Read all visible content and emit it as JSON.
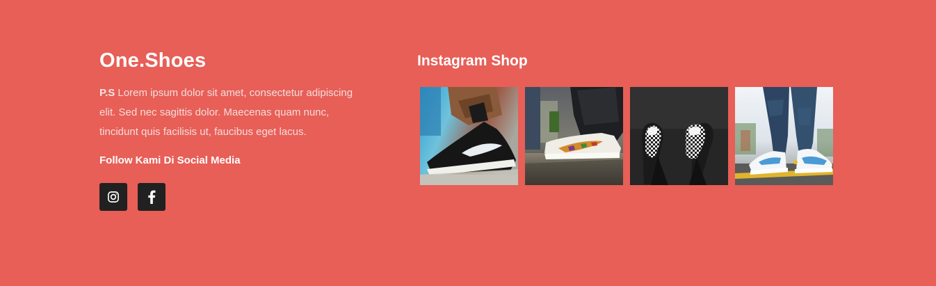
{
  "footer": {
    "brand": "One.Shoes",
    "about_prefix": "P.S",
    "about_text": " Lorem ipsum dolor sit amet, consectetur adipiscing elit. Sed nec sagittis dolor. Maecenas quam nunc, tincidunt quis facilisis ut, faucibus eget lacus.",
    "follow_heading": "Follow Kami Di Social Media",
    "socials": [
      {
        "icon": "instagram-icon"
      },
      {
        "icon": "facebook-icon"
      }
    ]
  },
  "instagram": {
    "title": "Instagram Shop",
    "photos": [
      {
        "subject": "black sneaker with white swoosh"
      },
      {
        "subject": "white sneaker with colorful swoosh"
      },
      {
        "subject": "black and white patterned sneakers"
      },
      {
        "subject": "white and blue high-top sneakers on road"
      }
    ]
  },
  "colors": {
    "background": "#e75f57",
    "icon_button": "#212121",
    "text": "#ffffff"
  }
}
